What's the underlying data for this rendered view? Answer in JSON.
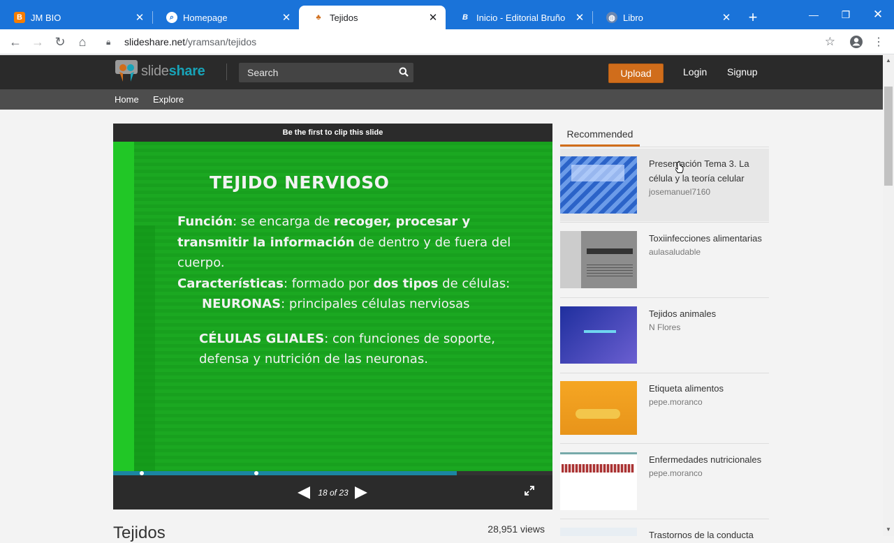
{
  "browser": {
    "tabs": [
      {
        "label": "JM BIO",
        "icon": "blogger-icon"
      },
      {
        "label": "Homepage",
        "icon": "search-favicon"
      },
      {
        "label": "Tejidos",
        "icon": "slideshare-favicon",
        "active": true
      },
      {
        "label": "Inicio - Editorial Bruño",
        "icon": "bruno-favicon"
      },
      {
        "label": "Libro",
        "icon": "globe-favicon"
      }
    ],
    "url_domain": "slideshare.net",
    "url_path": "/yramsan/tejidos"
  },
  "header": {
    "logo_slide": "slide",
    "logo_share": "share",
    "search_placeholder": "Search",
    "upload_label": "Upload",
    "login_label": "Login",
    "signup_label": "Signup"
  },
  "subnav": {
    "home": "Home",
    "explore": "Explore"
  },
  "player": {
    "clip_text": "Be the first to clip this slide",
    "page_indicator": "18 of 23",
    "current_page": 18,
    "total_pages": 23,
    "slide": {
      "title": "TEJIDO NERVIOSO",
      "funcion_label": "Función",
      "funcion_text1": ": se encarga de ",
      "funcion_bold1": "recoger, procesar y transmitir la información",
      "funcion_text2": " de dentro y de fuera del cuerpo.",
      "caract_label": "Características",
      "caract_text1": ": formado por ",
      "caract_bold": "dos tipos",
      "caract_text2": " de células:",
      "neuronas_label": "NEURONAS",
      "neuronas_text": ": principales células nerviosas",
      "gliales_label": "CÉLULAS GLIALES",
      "gliales_text": ": con funciones de soporte, defensa y nutrición de las neuronas."
    }
  },
  "document": {
    "title": "Tejidos",
    "views": "28,951 views"
  },
  "recommended": {
    "tab_label": "Recommended",
    "items": [
      {
        "title": "Presentación Tema 3. La célula y la teoría celular",
        "author": "josemanuel7160"
      },
      {
        "title": "Toxiinfecciones alimentarias",
        "author": "aulasaludable"
      },
      {
        "title": "Tejidos animales",
        "author": "N Flores"
      },
      {
        "title": "Etiqueta alimentos",
        "author": "pepe.moranco"
      },
      {
        "title": "Enfermedades nutricionales",
        "author": "pepe.moranco"
      },
      {
        "title": "Trastornos de la conducta",
        "author": ""
      }
    ]
  },
  "colors": {
    "brand_orange": "#d06d1b",
    "slideshare_teal": "#18a3b8",
    "chrome_blue": "#1a73d9",
    "slide_green": "#1ba821"
  }
}
